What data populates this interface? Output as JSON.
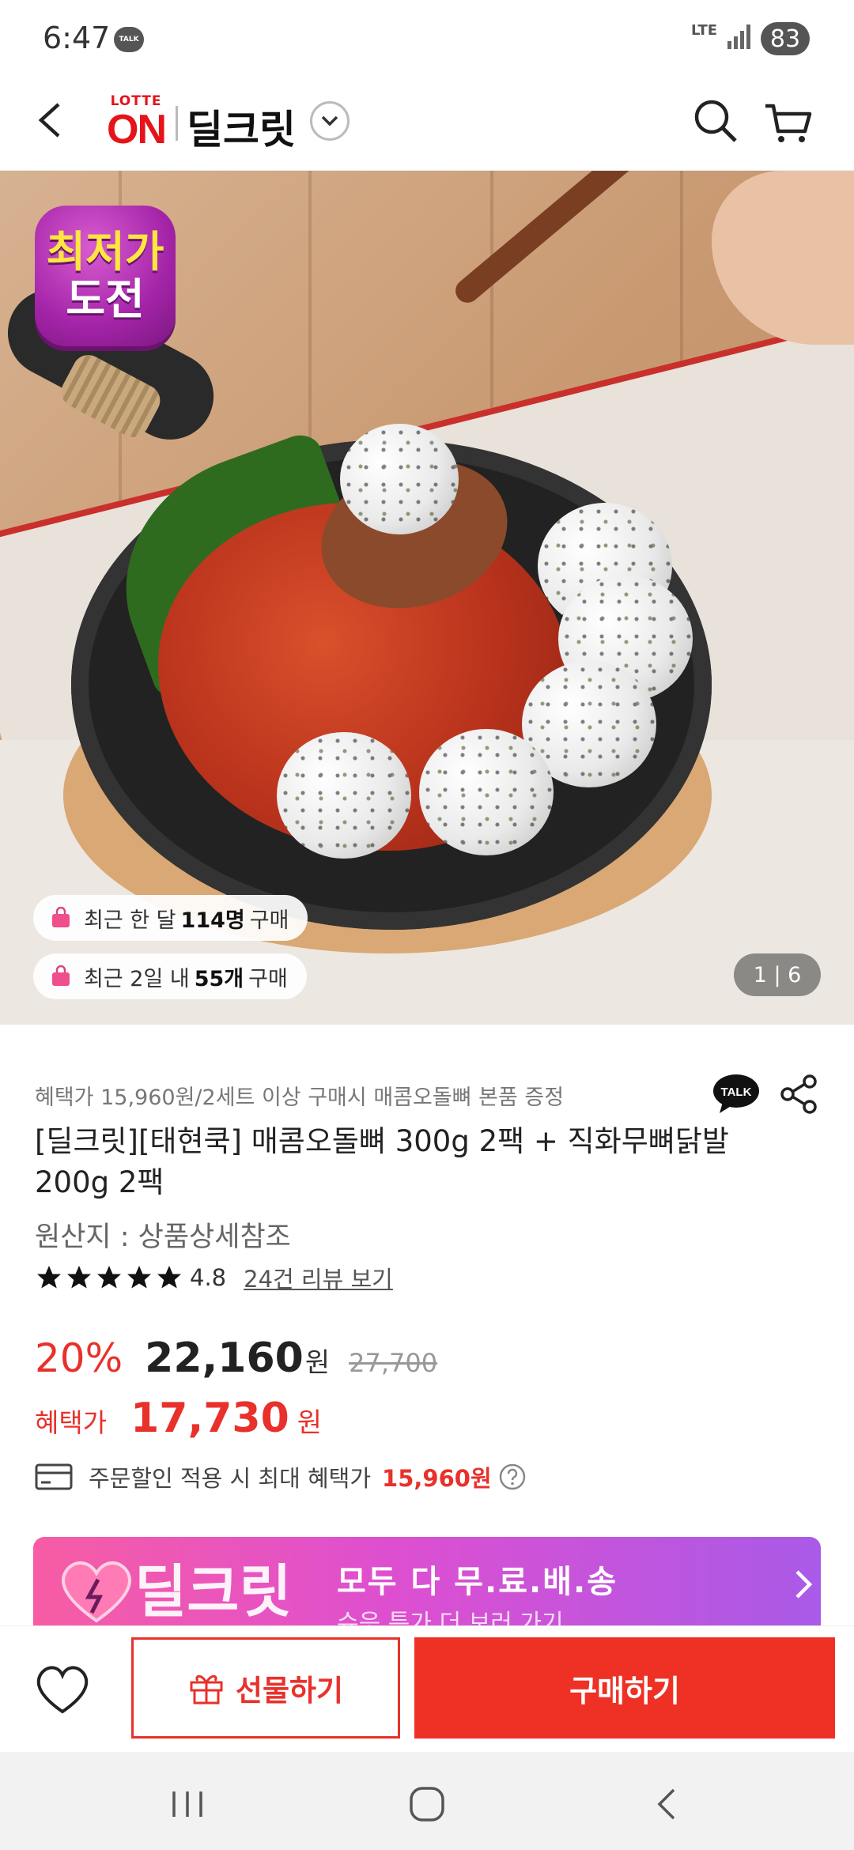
{
  "status_bar": {
    "time": "6:47",
    "talk_label": "TALK",
    "network": "LTE",
    "battery": "83"
  },
  "header": {
    "logo_top": "LOTTE",
    "logo_bottom": "ON",
    "brand": "딜크릿"
  },
  "hero": {
    "badge_line1": "최저가",
    "badge_line2": "도전",
    "stat1": {
      "prefix": "최근 한 달",
      "value": "114명",
      "suffix": "구매"
    },
    "stat2": {
      "prefix": "최근 2일 내",
      "value": "55개",
      "suffix": "구매"
    },
    "page_indicator": "1 | 6"
  },
  "product": {
    "benefit_line": "혜택가 15,960원/2세트 이상 구매시 매콤오돌뼈 본품 증정",
    "title": "[딜크릿][태현쿡] 매콤오돌뼈 300g 2팩 + 직화무뼈닭발 200g 2팩",
    "origin": "원산지 : 상품상세참조",
    "rating": "4.8",
    "rating_fraction": 0.96,
    "review_link": "24건 리뷰 보기",
    "talk_icon_label": "TALK"
  },
  "price": {
    "discount": "20%",
    "sale_price": "22,160",
    "unit": "원",
    "original_price": "27,700",
    "benefit_label": "혜택가",
    "benefit_price": "17,730",
    "benefit_unit": "원",
    "max_text": "주문할인 적용 시 최대 혜택가",
    "max_price": "15,960원"
  },
  "promo": {
    "brand": "딜크릿",
    "title": "모두 다 무.료.배.송",
    "subtitle": "슈읏 특가 더 보러 가기"
  },
  "actions": {
    "gift_label": "선물하기",
    "buy_label": "구매하기"
  },
  "colors": {
    "accent_red": "#e8312b",
    "buy_button": "#ee3124",
    "badge_purple": "#a424a8"
  }
}
